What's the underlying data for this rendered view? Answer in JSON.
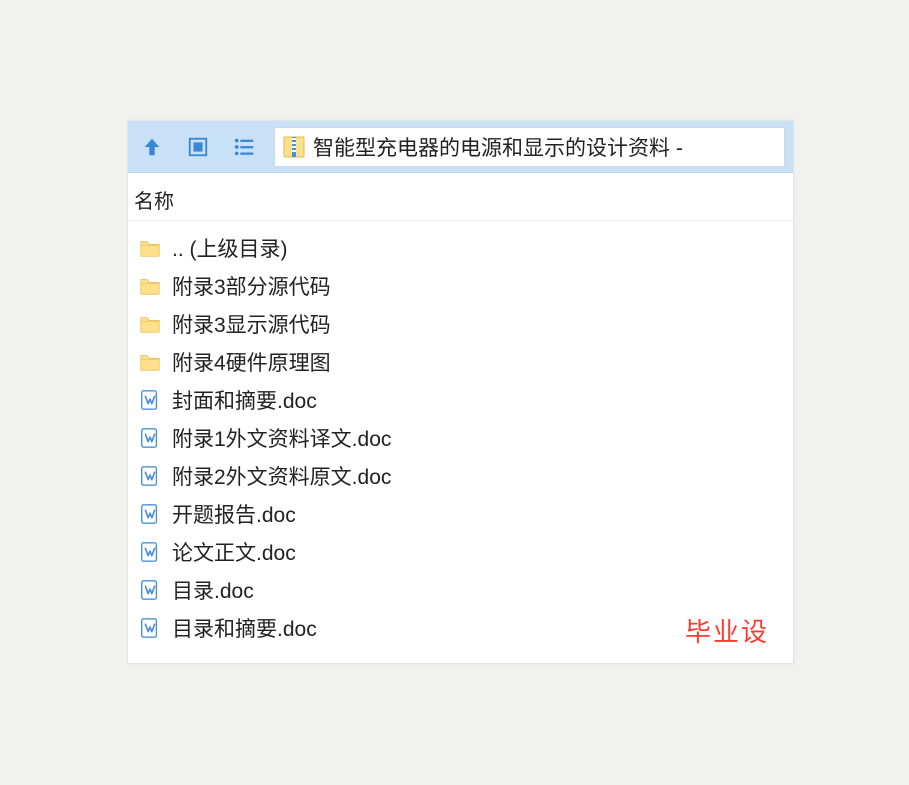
{
  "toolbar": {
    "breadcrumb_text": "智能型充电器的电源和显示的设计资料 -"
  },
  "columns": {
    "name": "名称"
  },
  "items": [
    {
      "type": "folder",
      "label": ".. (上级目录)"
    },
    {
      "type": "folder",
      "label": "附录3部分源代码"
    },
    {
      "type": "folder",
      "label": "附录3显示源代码"
    },
    {
      "type": "folder",
      "label": "附录4硬件原理图"
    },
    {
      "type": "doc",
      "label": "封面和摘要.doc"
    },
    {
      "type": "doc",
      "label": "附录1外文资料译文.doc"
    },
    {
      "type": "doc",
      "label": "附录2外文资料原文.doc"
    },
    {
      "type": "doc",
      "label": "开题报告.doc"
    },
    {
      "type": "doc",
      "label": "论文正文.doc"
    },
    {
      "type": "doc",
      "label": "目录.doc"
    },
    {
      "type": "doc",
      "label": "目录和摘要.doc"
    }
  ],
  "watermark": "毕业设"
}
